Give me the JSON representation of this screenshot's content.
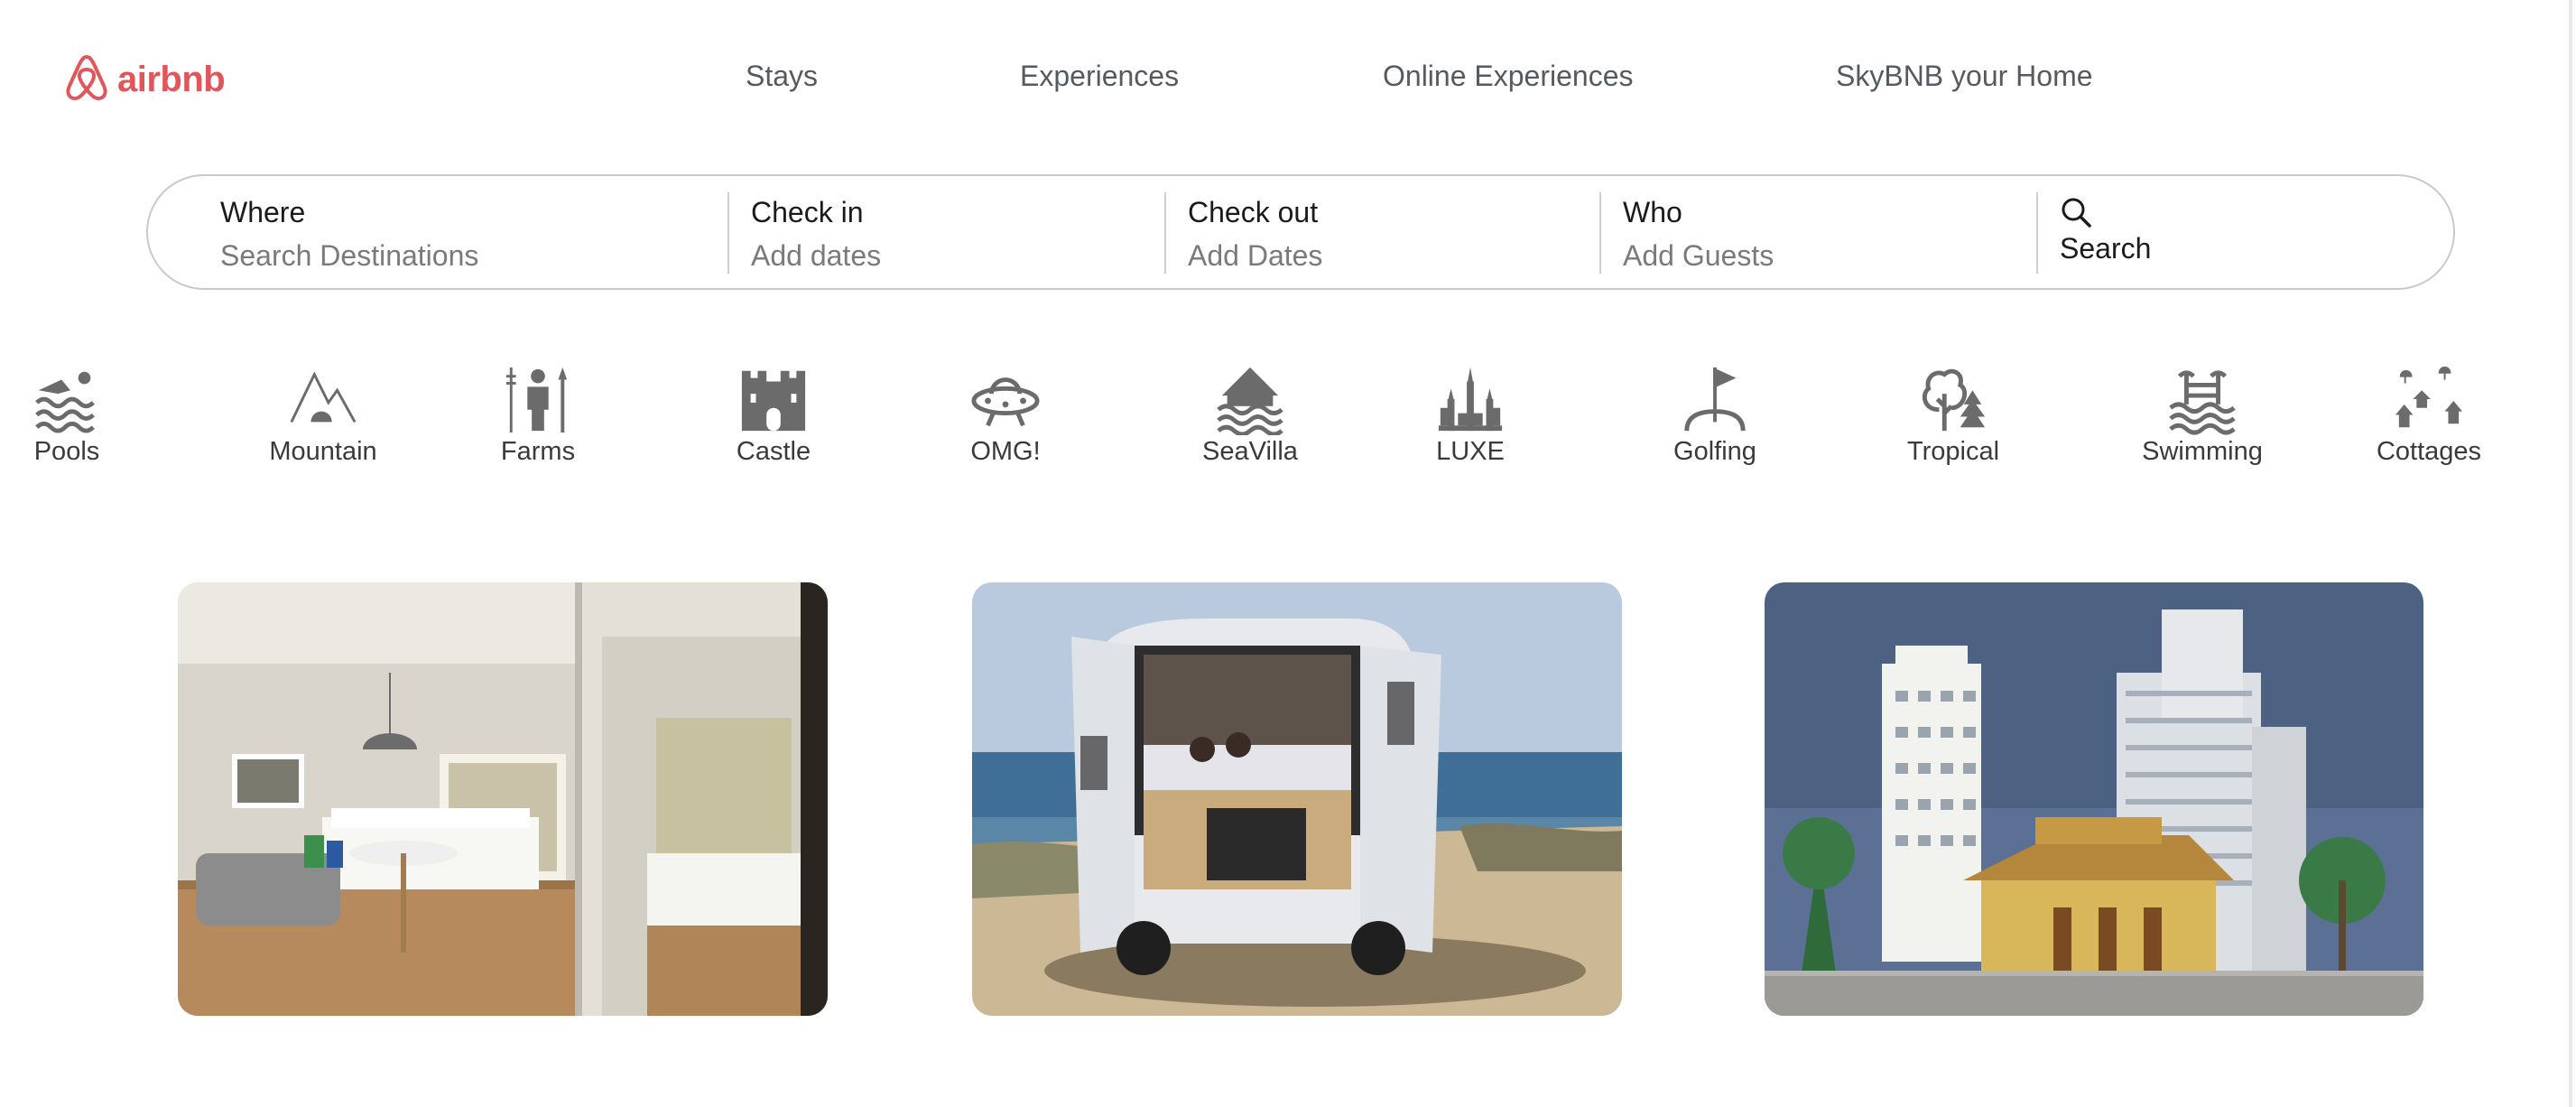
{
  "brand": {
    "name": "airbnb",
    "icon": "airbnb-logo-icon",
    "color": "#e0565b"
  },
  "nav": {
    "items": [
      {
        "label": "Stays"
      },
      {
        "label": "Experiences"
      },
      {
        "label": "Online Experiences"
      },
      {
        "label": "SkyBNB your Home"
      }
    ]
  },
  "search": {
    "where": {
      "label": "Where",
      "placeholder": "Search Destinations"
    },
    "checkin": {
      "label": "Check in",
      "placeholder": "Add dates"
    },
    "checkout": {
      "label": "Check out",
      "placeholder": "Add Dates"
    },
    "who": {
      "label": "Who",
      "placeholder": "Add Guests"
    },
    "button": {
      "label": "Search",
      "icon": "search-icon"
    }
  },
  "categories": [
    {
      "label": "Pools",
      "icon": "pool-icon"
    },
    {
      "label": "Mountain",
      "icon": "mountain-icon"
    },
    {
      "label": "Farms",
      "icon": "farm-icon"
    },
    {
      "label": "Castle",
      "icon": "castle-icon"
    },
    {
      "label": "OMG!",
      "icon": "ufo-icon"
    },
    {
      "label": "SeaVilla",
      "icon": "sea-villa-icon"
    },
    {
      "label": "LUXE",
      "icon": "luxe-icon"
    },
    {
      "label": "Golfing",
      "icon": "golf-icon"
    },
    {
      "label": "Tropical",
      "icon": "tropical-tree-icon"
    },
    {
      "label": "Swimming",
      "icon": "swimming-icon"
    },
    {
      "label": "Cottages",
      "icon": "cottage-icon"
    }
  ],
  "cards": [
    {
      "image": "hotel-room-photo"
    },
    {
      "image": "camper-van-beach-photo"
    },
    {
      "image": "temple-towers-photo"
    }
  ],
  "colors": {
    "text_nav": "#555a62",
    "text_muted": "#7a7a7a",
    "icon": "#6b6b6b",
    "border": "#c9c9c9"
  }
}
